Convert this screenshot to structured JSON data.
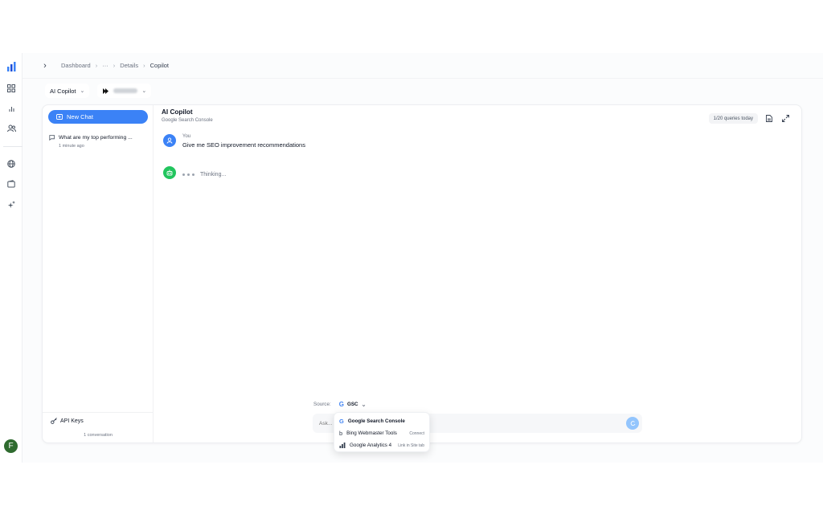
{
  "breadcrumb": {
    "items": [
      "Dashboard",
      "···",
      "Details"
    ],
    "current": "Copilot"
  },
  "selectors": {
    "assistant": "AI Copilot"
  },
  "sidebar": {
    "new_chat_label": "New Chat",
    "conversations": [
      {
        "title": "What are my top performing ...",
        "time": "1 minute ago"
      }
    ],
    "api_keys_label": "API Keys",
    "conversation_count": "1 conversation"
  },
  "chat": {
    "title": "AI Copilot",
    "subtitle": "Google Search Console",
    "quota": "1/20 queries today",
    "messages": [
      {
        "author": "You",
        "text": "Give me SEO improvement recommendations"
      },
      {
        "author": "assistant",
        "status": "Thinking..."
      }
    ]
  },
  "source": {
    "label": "Source:",
    "selected": "GSC",
    "options": [
      {
        "label": "Google Search Console",
        "tag": ""
      },
      {
        "label": "Bing Webmaster Tools",
        "tag": "Connect"
      },
      {
        "label": "Google Analytics 4",
        "tag": "Link in Site tab"
      }
    ]
  },
  "input": {
    "placeholder": "Ask..."
  },
  "user": {
    "initial": "F"
  },
  "colors": {
    "accent": "#3b82f6",
    "assistant": "#22c55e",
    "avatar": "#2f6b2f"
  }
}
